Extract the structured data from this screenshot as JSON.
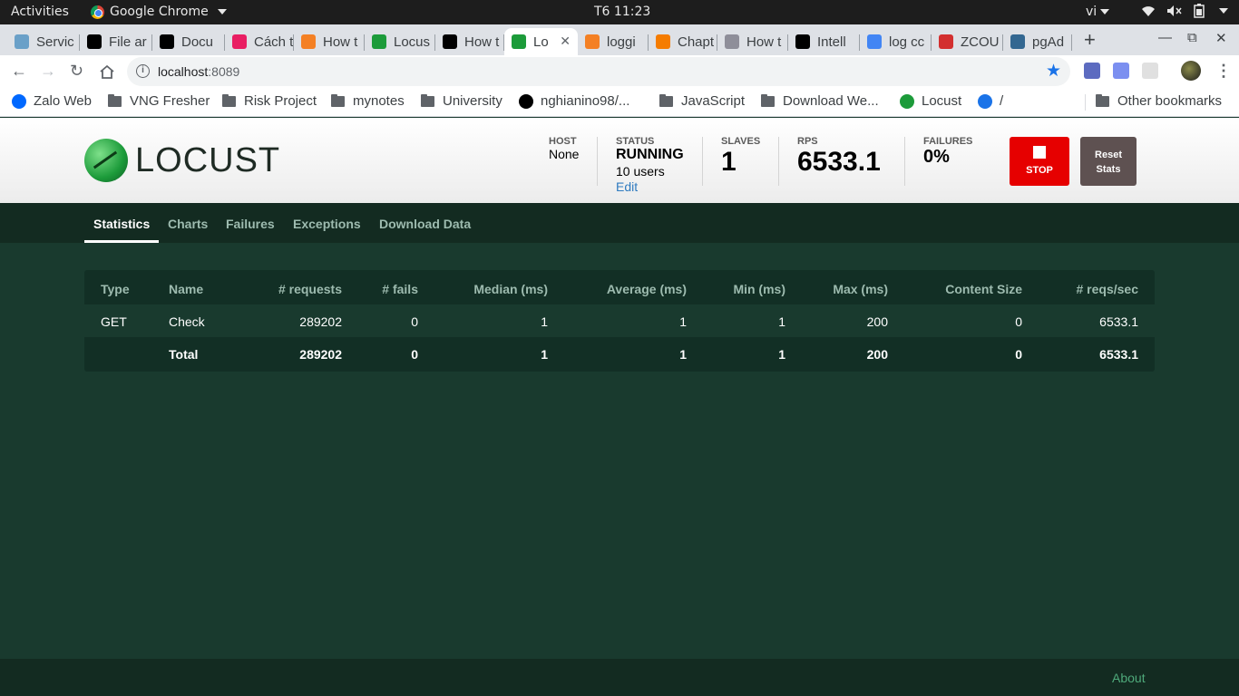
{
  "os_bar": {
    "activities": "Activities",
    "app_name": "Google Chrome",
    "clock": "T6 11:23",
    "language": "vi"
  },
  "tabs": [
    {
      "title": "Servic",
      "favicon_color": "#6aa0c8",
      "icon": "service-favicon"
    },
    {
      "title": "File ar",
      "favicon_color": "#000000",
      "icon": "jetbrains-favicon"
    },
    {
      "title": "Docu",
      "favicon_color": "#000000",
      "icon": "jetbrains-favicon"
    },
    {
      "title": "Cách t",
      "favicon_color": "#e91e63",
      "icon": "t-favicon"
    },
    {
      "title": "How t",
      "favicon_color": "#f48024",
      "icon": "stackoverflow-favicon"
    },
    {
      "title": "Locus",
      "favicon_color": "#1c9b3a",
      "icon": "locust-favicon"
    },
    {
      "title": "How t",
      "favicon_color": "#000000",
      "icon": "github-favicon"
    },
    {
      "title": "Lo",
      "favicon_color": "#1c9b3a",
      "icon": "locust-favicon",
      "active": true
    },
    {
      "title": "loggi",
      "favicon_color": "#f48024",
      "icon": "stackoverflow-favicon"
    },
    {
      "title": "Chapt",
      "favicon_color": "#f57c00",
      "icon": "chapter-favicon"
    },
    {
      "title": "How t",
      "favicon_color": "#8e8e99",
      "icon": "howto-favicon"
    },
    {
      "title": "Intell",
      "favicon_color": "#000000",
      "icon": "jetbrains-favicon"
    },
    {
      "title": "log cc",
      "favicon_color": "#4285f4",
      "icon": "google-favicon"
    },
    {
      "title": "ZCOU",
      "favicon_color": "#d32f2f",
      "icon": "redis-favicon"
    },
    {
      "title": "pgAd",
      "favicon_color": "#336791",
      "icon": "pgadmin-favicon"
    }
  ],
  "toolbar": {
    "url_host": "localhost",
    "url_port": ":8089"
  },
  "bookmarks": [
    {
      "label": "Zalo Web",
      "type": "site",
      "color": "#0068ff"
    },
    {
      "label": "VNG Fresher",
      "type": "folder"
    },
    {
      "label": "Risk Project",
      "type": "folder"
    },
    {
      "label": "mynotes",
      "type": "folder"
    },
    {
      "label": "University",
      "type": "folder"
    },
    {
      "label": "nghianino98/...",
      "type": "site",
      "color": "#000000"
    },
    {
      "label": "JavaScript",
      "type": "folder"
    },
    {
      "label": "Download We...",
      "type": "folder"
    },
    {
      "label": "Locust",
      "type": "site",
      "color": "#1c9b3a"
    },
    {
      "label": "/",
      "type": "site",
      "color": "#1a73e8"
    },
    {
      "label": "Other bookmarks",
      "type": "folder"
    }
  ],
  "locust": {
    "logo_text": "LOCUST",
    "host": {
      "label": "HOST",
      "value": "None"
    },
    "status": {
      "label": "STATUS",
      "value": "RUNNING",
      "users": "10 users",
      "edit": "Edit"
    },
    "slaves": {
      "label": "SLAVES",
      "value": "1"
    },
    "rps": {
      "label": "RPS",
      "value": "6533.1"
    },
    "failures": {
      "label": "FAILURES",
      "value": "0%"
    },
    "stop_label": "STOP",
    "reset_label_1": "Reset",
    "reset_label_2": "Stats",
    "nav": [
      "Statistics",
      "Charts",
      "Failures",
      "Exceptions",
      "Download Data"
    ],
    "active_nav": "Statistics",
    "table": {
      "headers": [
        "Type",
        "Name",
        "# requests",
        "# fails",
        "Median (ms)",
        "Average (ms)",
        "Min (ms)",
        "Max (ms)",
        "Content Size",
        "# reqs/sec"
      ],
      "rows": [
        [
          "GET",
          "Check",
          "289202",
          "0",
          "1",
          "1",
          "1",
          "200",
          "0",
          "6533.1"
        ]
      ],
      "total": [
        "",
        "Total",
        "289202",
        "0",
        "1",
        "1",
        "1",
        "200",
        "0",
        "6533.1"
      ]
    },
    "footer_link": "About"
  }
}
